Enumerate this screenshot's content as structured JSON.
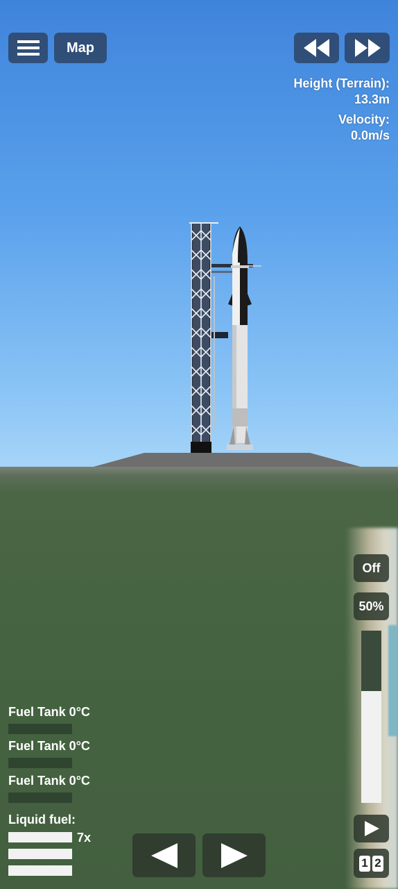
{
  "hud": {
    "menu_icon": "hamburger-icon",
    "map_label": "Map",
    "rewind_icon": "rewind-icon",
    "fast_forward_icon": "fast-forward-icon",
    "height_label": "Height (Terrain):",
    "height_value": "13.3m",
    "velocity_label": "Velocity:",
    "velocity_value": "0.0m/s"
  },
  "fuel": {
    "tanks": [
      {
        "label": "Fuel Tank 0°C"
      },
      {
        "label": "Fuel Tank 0°C"
      },
      {
        "label": "Fuel Tank 0°C"
      }
    ],
    "liquid_label": "Liquid fuel:",
    "liquid_multiplier": "7x"
  },
  "controls": {
    "off_label": "Off",
    "throttle_label": "50%",
    "throttle_fill": 0.65,
    "stage_play_icon": "play-icon",
    "stage_digit_1": "1",
    "stage_digit_2": "2",
    "rotate_left_icon": "triangle-left-icon",
    "rotate_right_icon": "triangle-right-icon"
  },
  "colors": {
    "sky_top": "#3f84db",
    "ground": "#435f3f",
    "button_bg": "#283750"
  }
}
